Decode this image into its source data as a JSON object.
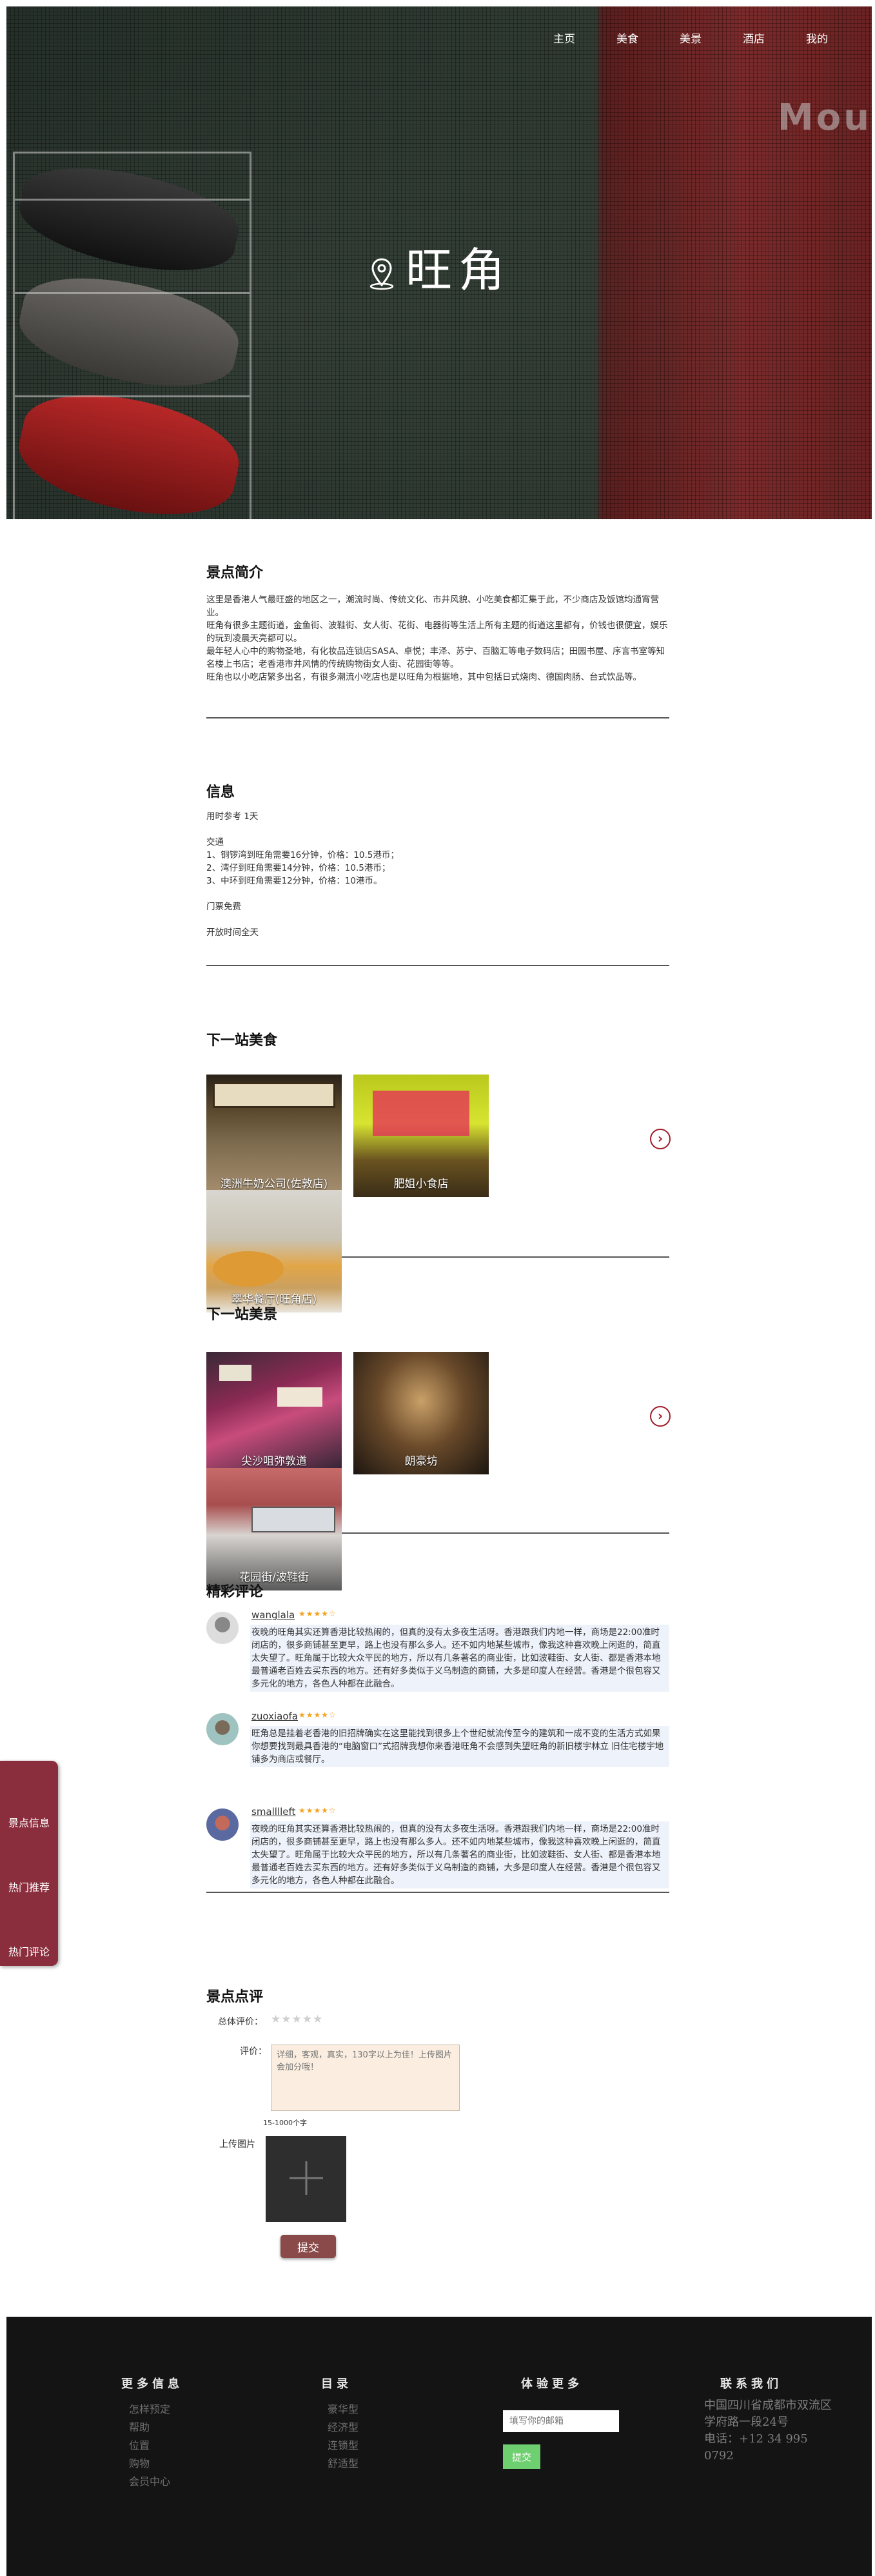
{
  "nav": [
    "主页",
    "美食",
    "美景",
    "酒店",
    "我的"
  ],
  "hero": {
    "title": "旺角",
    "sign_text": "Mou"
  },
  "intro": {
    "title": "景点简介",
    "paragraphs": [
      "这里是香港人气最旺盛的地区之一，潮流时尚、传统文化、市井风貌、小吃美食都汇集于此，不少商店及饭馆均通宵营业。",
      "旺角有很多主题街道，金鱼街、波鞋街、女人街、花街、电器街等生活上所有主题的街道这里都有，价钱也很便宜，娱乐的玩到凌晨天亮都可以。",
      "最年轻人心中的购物圣地，有化妆品连锁店SASA、卓悦；丰泽、苏宁、百脑汇等电子数码店；田园书屋、序言书室等知名楼上书店；老香港市井风情的传统购物街女人街、花园街等等。",
      "旺角也以小吃店繁多出名，有很多潮流小吃店也是以旺角为根据地，其中包括日式烧肉、德国肉肠、台式饮品等。"
    ]
  },
  "info": {
    "title": "信息",
    "duration": "用时参考 1天",
    "traffic_title": "交通",
    "traffic": [
      "1、铜锣湾到旺角需要16分钟，价格：10.5港币；",
      "2、湾仔到旺角需要14分钟，价格：10.5港币；",
      "3、中环到旺角需要12分钟，价格：10港币。"
    ],
    "ticket": "门票免费",
    "hours": "开放时间全天"
  },
  "food": {
    "title": "下一站美食",
    "cards": [
      "澳洲牛奶公司(佐敦店)",
      "肥姐小食店",
      "翠华餐厅(旺角店)"
    ],
    "arrow": "›"
  },
  "sights": {
    "title": "下一站美景",
    "cards": [
      "尖沙咀弥敦道",
      "朗豪坊",
      "花园街/波鞋街"
    ],
    "arrow": "›"
  },
  "comments": {
    "title": "精彩评论",
    "items": [
      {
        "user": "wanglala",
        "stars": "★★★★☆",
        "text": "夜晚的旺角其实还算香港比较热闹的，但真的没有太多夜生活呀。香港跟我们内地一样，商场是22:00准时闭店的，很多商铺甚至更早，路上也没有那么多人。还不如内地某些城市，像我这种喜欢晚上闲逛的，简直太失望了。旺角属于比较大众平民的地方，所以有几条著名的商业街，比如波鞋街、女人街、都是香港本地最普通老百姓去买东西的地方。还有好多类似于义乌制造的商铺，大多是印度人在经营。香港是个很包容又多元化的地方，各色人种都在此融合。"
      },
      {
        "user": "zuoxiaofa",
        "stars": "★★★★☆",
        "text": "旺角总是挂着老香港的旧招牌确实在这里能找到很多上个世纪就流传至今的建筑和一成不变的生活方式如果你想要找到最具香港的“电脑窗口”式招牌我想你来香港旺角不会感到失望旺角的新旧楼宇林立 旧住宅楼宇地铺多为商店或餐厅。"
      },
      {
        "user": "smalllleft",
        "stars": "★★★★☆",
        "text": "夜晚的旺角其实还算香港比较热闹的，但真的没有太多夜生活呀。香港跟我们内地一样，商场是22:00准时闭店的，很多商铺甚至更早，路上也没有那么多人。还不如内地某些城市，像我这种喜欢晚上闲逛的，简直太失望了。旺角属于比较大众平民的地方，所以有几条著名的商业街，比如波鞋街、女人街、都是香港本地最普通老百姓去买东西的地方。还有好多类似于义乌制造的商铺，大多是印度人在经营。香港是个很包容又多元化的地方，各色人种都在此融合。"
      }
    ]
  },
  "side_menu": [
    "景点信息",
    "热门推荐",
    "热门评论"
  ],
  "review": {
    "title": "景点点评",
    "overall_label": "总体评价：",
    "stars": "★★★★★",
    "rating_label": "评价：",
    "placeholder": "详细，客观，真实，130字以上为佳！上传图片会加分哦！",
    "count_hint": "15-1000个字",
    "upload_label": "上传图片",
    "submit": "提交"
  },
  "footer": {
    "col1": {
      "title": "更多信息",
      "links": [
        "怎样预定",
        "帮助",
        "位置",
        "购物",
        "会员中心"
      ]
    },
    "col2": {
      "title": "目录",
      "links": [
        "豪华型",
        "经济型",
        "连锁型",
        "舒适型"
      ]
    },
    "col3": {
      "title": "体验更多",
      "placeholder": "填写你的邮箱",
      "button": "提交"
    },
    "col4": {
      "title": "联系我们",
      "address": "中国四川省成都市双流区学府路一段24号",
      "phone": "电话：+12 34 995 0792"
    }
  },
  "colors": {
    "accent": "#a01d2a",
    "side_menu": "#8a2e3d",
    "submit": "#8a4a4a",
    "footer_bg": "#141414",
    "subscribe": "#6ecf70"
  }
}
